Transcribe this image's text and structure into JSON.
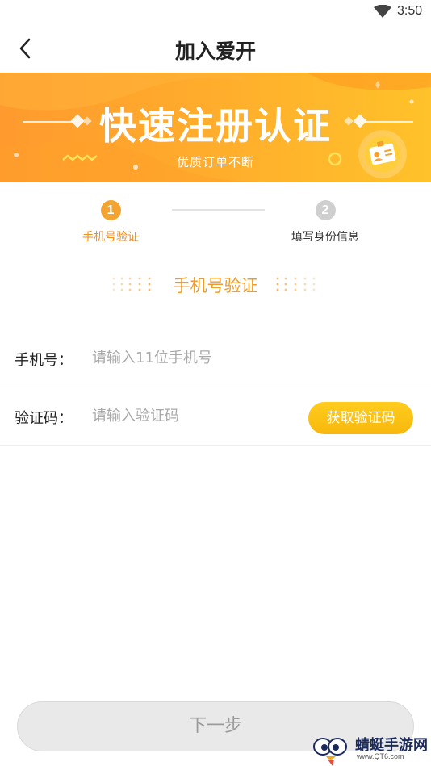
{
  "status_bar": {
    "time": "3:50"
  },
  "header": {
    "title": "加入爱开",
    "back_icon": "chevron-left-icon"
  },
  "banner": {
    "title": "快速注册认证",
    "subtitle": "优质订单不断",
    "colors": {
      "start": "#ff9a2e",
      "end": "#ffc22a"
    }
  },
  "steps": [
    {
      "number": "1",
      "label": "手机号验证",
      "active": true
    },
    {
      "number": "2",
      "label": "填写身份信息",
      "active": false
    }
  ],
  "section": {
    "title": "手机号验证"
  },
  "form": {
    "phone": {
      "label": "手机号：",
      "placeholder": "请输入11位手机号",
      "value": ""
    },
    "code": {
      "label": "验证码：",
      "placeholder": "请输入验证码",
      "value": ""
    },
    "get_code_label": "获取验证码"
  },
  "next_label": "下一步",
  "watermark": {
    "text": "蜻蜓手游网",
    "sub": "www.QT6.com"
  },
  "colors": {
    "accent": "#f4a32e",
    "button_yellow": "#fbbd12",
    "disabled": "#e9e9e9"
  }
}
